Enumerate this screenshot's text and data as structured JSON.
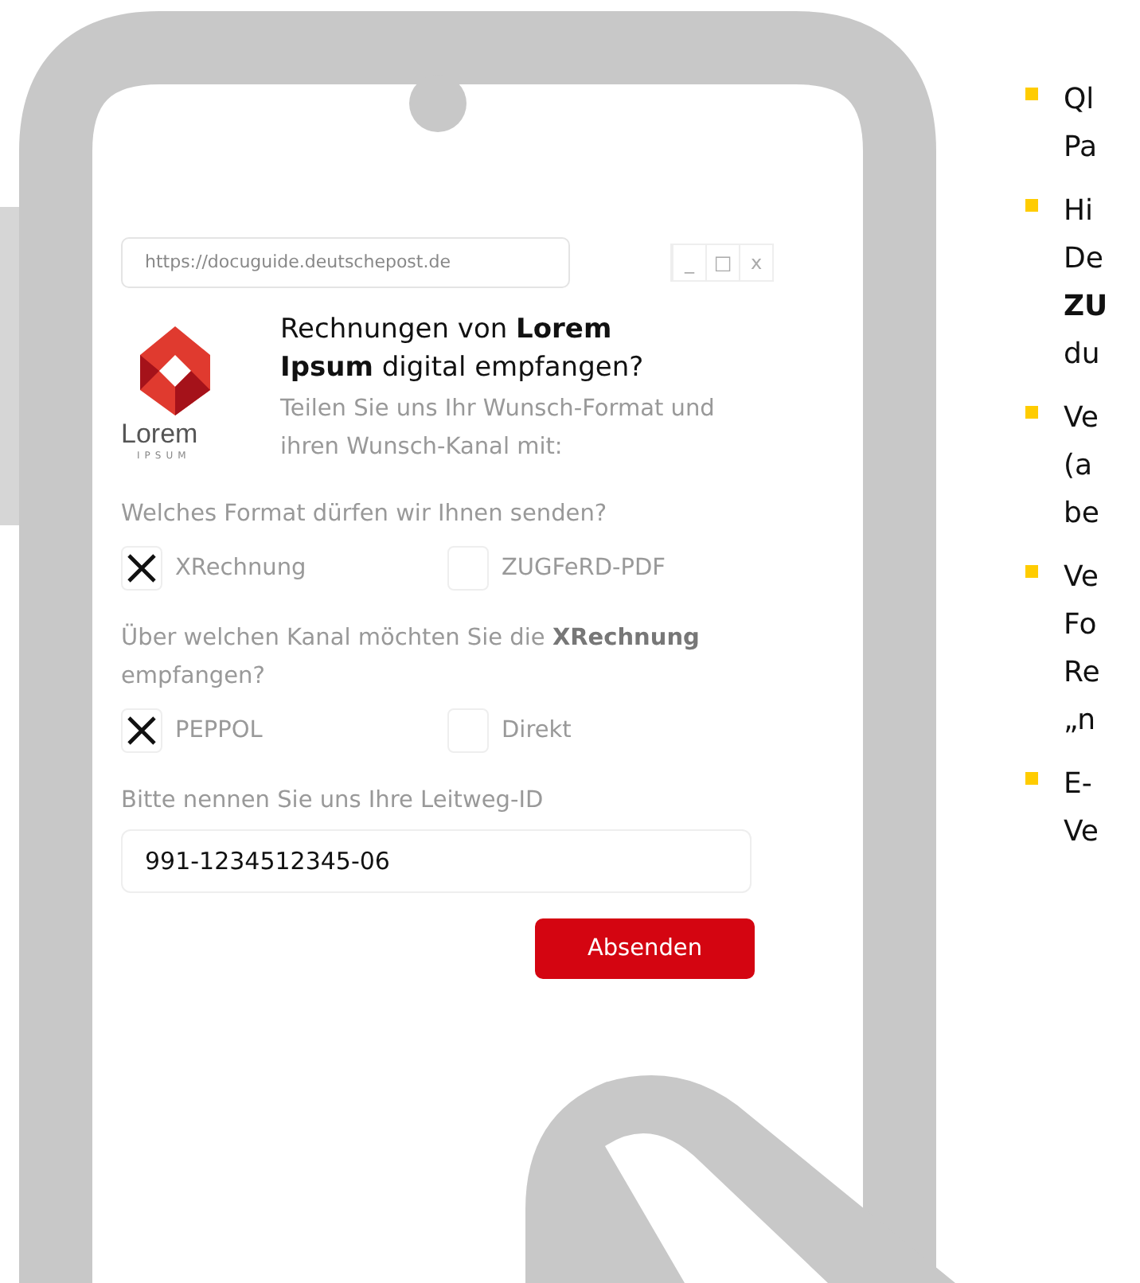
{
  "browser": {
    "url": "https://docuguide.deutschepost.de",
    "controls": [
      "_",
      "□",
      "x"
    ]
  },
  "logo": {
    "name": "Lorem",
    "tagline": "IPSUM"
  },
  "heading": "Rechnungen von **Lorem Ipsum** digital empfangen?",
  "subtitle": "Teilen Sie uns Ihr Wunsch-Format und ihren Wunsch-Kanal mit:",
  "questions": [
    {
      "label": "Welches Format dürfen wir Ihnen senden?",
      "options": [
        {
          "label": "XRechnung",
          "checked": true
        },
        {
          "label": "ZUGFeRD-PDF",
          "checked": false
        }
      ]
    },
    {
      "label": "Über welchen Kanal möchten Sie die **XRechnung** empfangen?",
      "options": [
        {
          "label": "PEPPOL",
          "checked": true
        },
        {
          "label": "Direkt",
          "checked": false
        }
      ]
    }
  ],
  "leitweg": {
    "label": "Bitte nennen Sie uns Ihre Leitweg-ID",
    "value": "991-1234512345-06"
  },
  "submit": "Absenden",
  "bullets": [
    {
      "lines": [
        "Ql",
        "Pa"
      ]
    },
    {
      "lines": [
        "Hi",
        "De",
        "**ZU**",
        "du"
      ]
    },
    {
      "lines": [
        "Ve",
        "(a",
        "be"
      ]
    },
    {
      "lines": [
        "Ve",
        "Fo",
        "Re",
        "„n"
      ]
    },
    {
      "lines": [
        "E-",
        "Ve"
      ]
    }
  ]
}
